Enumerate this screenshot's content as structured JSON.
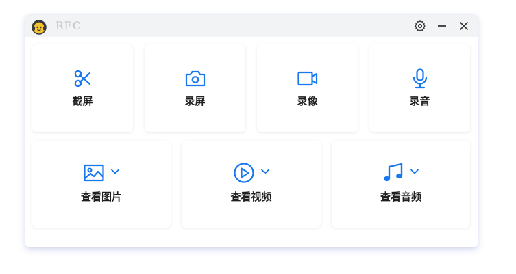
{
  "window": {
    "title": "REC",
    "logo_icon": "headphones-mascot-icon",
    "controls": {
      "settings_icon": "gear-icon",
      "minimize_icon": "minimize-icon",
      "close_icon": "close-icon"
    }
  },
  "top_actions": [
    {
      "label": "截屏",
      "icon": "scissors-icon"
    },
    {
      "label": "录屏",
      "icon": "camera-icon"
    },
    {
      "label": "录像",
      "icon": "video-camera-icon"
    },
    {
      "label": "录音",
      "icon": "microphone-icon"
    }
  ],
  "bottom_actions": [
    {
      "label": "查看图片",
      "icon": "image-icon",
      "dropdown_icon": "chevron-down-icon"
    },
    {
      "label": "查看视频",
      "icon": "play-circle-icon",
      "dropdown_icon": "chevron-down-icon"
    },
    {
      "label": "查看音频",
      "icon": "music-note-icon",
      "dropdown_icon": "chevron-down-icon"
    }
  ],
  "colors": {
    "accent": "#1677f0",
    "titlebar": "#f2f3f5",
    "title_text": "#c0c0c0",
    "label_text": "#1f1f1f"
  }
}
